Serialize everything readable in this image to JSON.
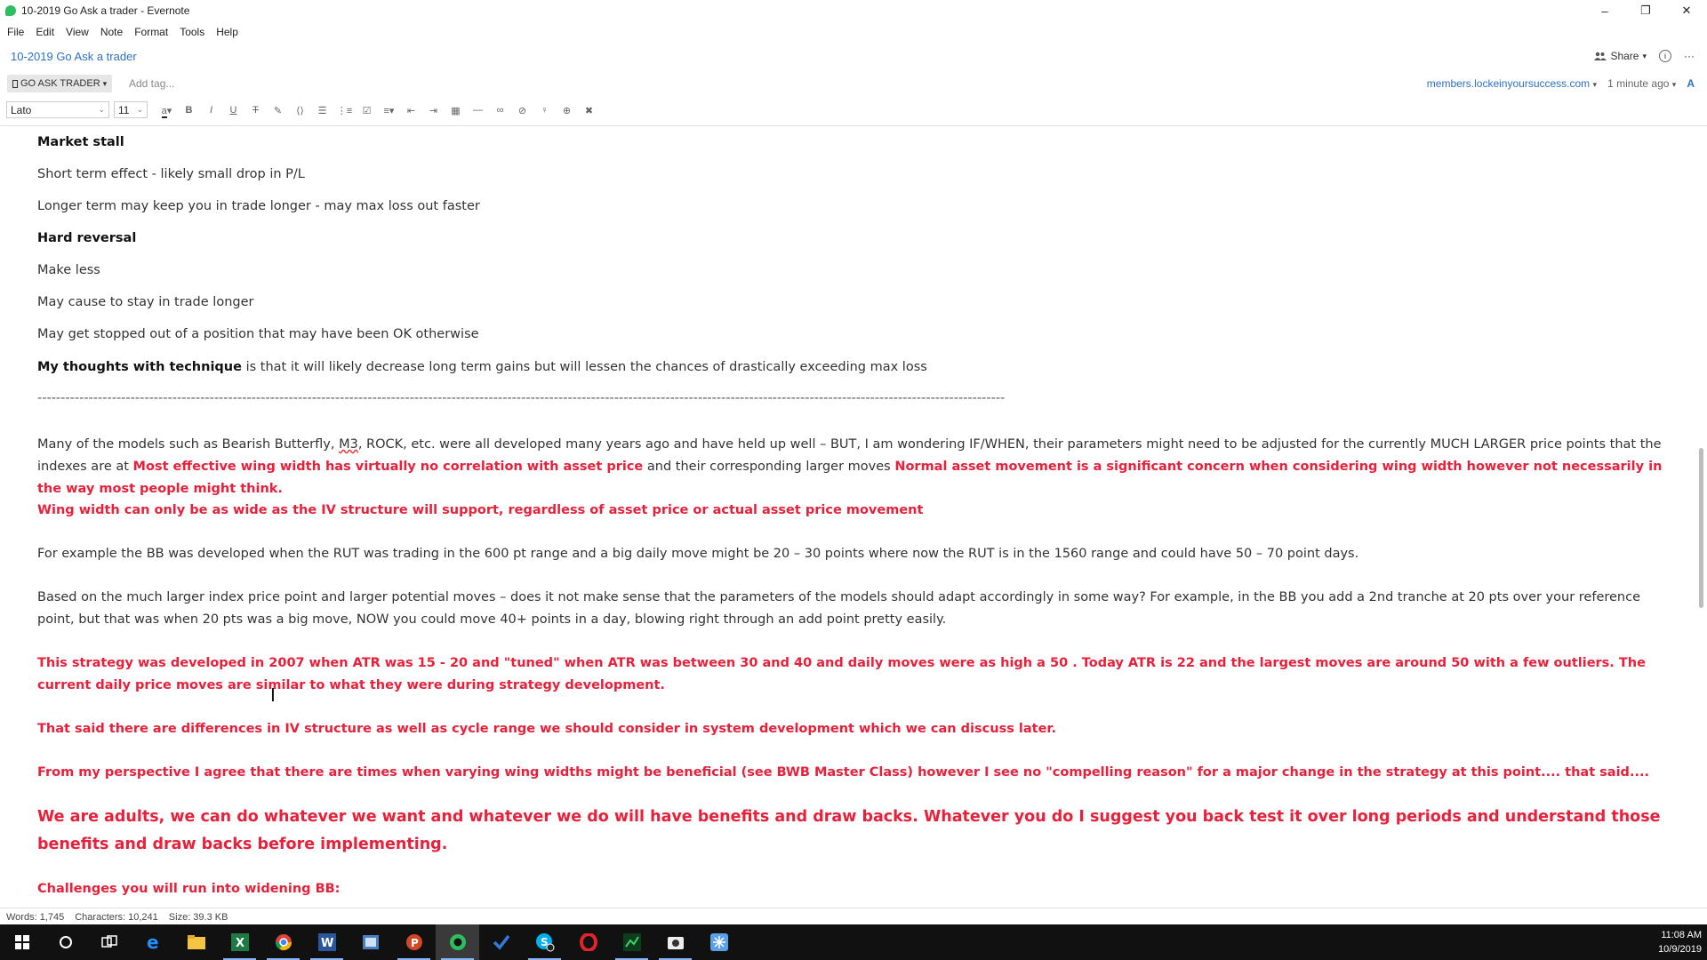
{
  "window": {
    "title": "10-2019 Go Ask a trader - Evernote",
    "controls": [
      "–",
      "❐",
      "✕"
    ]
  },
  "menu": [
    "File",
    "Edit",
    "View",
    "Note",
    "Format",
    "Tools",
    "Help"
  ],
  "note_header": {
    "title": "10-2019 Go Ask a trader",
    "share_label": "Share"
  },
  "tag_bar": {
    "notebook": "GO ASK TRADER",
    "add_tag_placeholder": "Add tag...",
    "source_url": "members.lockeinyoursuccess.com",
    "updated": "1 minute ago"
  },
  "toolbar": {
    "font": "Lato",
    "size": "11",
    "icons": [
      "text-color-icon",
      "bold-icon",
      "italic-icon",
      "underline-icon",
      "strikethrough-icon",
      "highlight-icon",
      "code-icon",
      "bullet-list-icon",
      "numbered-list-icon",
      "checkbox-icon",
      "align-icon",
      "outdent-icon",
      "indent-icon",
      "table-icon",
      "horizontal-rule-icon",
      "link-icon",
      "attach-icon",
      "record-icon",
      "insert-icon",
      "clear-format-icon"
    ]
  },
  "content": {
    "h_market_stall": "Market stall",
    "p1": "Short term effect - likely small drop in P/L",
    "p2": "Longer term may keep you in trade longer  - may max loss out faster",
    "h_hard_reversal": "Hard reversal",
    "p3": "Make less",
    "p4": "May cause to stay in trade longer",
    "p5": "May get stopped out of a position that may have been OK otherwise",
    "thoughts_bold": "My thoughts with technique",
    "thoughts_rest": " is that it will likely decrease long term gains but will lessen the chances of drastically exceeding max loss",
    "dashes": "----------------------------------------------------------------------------------------------------------------------------------------------------------------------------------------------------------------",
    "para_models_a": "Many of the models such as Bearish Butterfly, ",
    "para_models_m3": "M3",
    "para_models_b": ", ROCK, etc. were all developed many years ago and have held up well – BUT, I am wondering IF/WHEN, their parameters might need to be adjusted for the currently MUCH LARGER price points that the indexes are at ",
    "para_models_red1": "Most effective wing width has virtually no correlation with asset price",
    "para_models_c": " and their corresponding larger moves ",
    "para_models_red2": "Normal asset movement is a significant concern when considering wing width however not necessarily in the way most people might think.",
    "wing_width": "Wing width can only be as wide as the IV structure will support, regardless of asset price or actual asset price movement",
    "example": "For example the BB was developed when the RUT was trading in the 600 pt range and a big daily move might be 20 – 30 points where now the RUT is in the 1560 range and could have 50 – 70 point days.",
    "based_on": " Based on the much larger index price point and larger potential moves – does it not make sense that the parameters of the models should adapt accordingly in some way?  For example, in the BB you add a 2nd tranche at 20 pts over your reference point, but that was when 20 pts was a big move, NOW you could move 40+ points in a day, blowing right through an add point pretty easily.",
    "strategy_dev": "This strategy was developed in 2007 when ATR was 15 - 20 and \"tuned\" when ATR was between 30 and 40 and daily moves were as high a 50 . Today ATR is 22 and the largest moves  are  around 50 with a few outliers. The current daily price moves are similar to what they were during strategy development.",
    "that_said": "That said there are differences in IV structure as well as cycle range we should consider in system development which we can discuss later.",
    "perspective": "From my perspective I agree that there are times when varying wing  widths might be beneficial (see BWB Master Class) however I see no \"compelling reason\" for a major change in the strategy at this point.... that said....",
    "adults": "We are adults, we can do whatever we want and whatever we do will have benefits and draw backs. Whatever you do I suggest  you back test it over long periods and understand those benefits and draw backs before implementing.",
    "challenges": "Challenges you will run into widening BB:"
  },
  "status": {
    "words": "Words: 1,745",
    "characters": "Characters: 10,241",
    "size": "Size: 39.3 KB"
  },
  "taskbar": {
    "apps": [
      "windows-start-icon",
      "cortana-search-icon",
      "task-view-icon",
      "edge-browser-icon",
      "file-explorer-icon",
      "excel-icon",
      "chrome-icon",
      "word-icon",
      "reader-icon",
      "powerpoint-icon",
      "evernote-icon",
      "todo-check-icon",
      "skype-icon",
      "opera-icon",
      "trading-app-icon",
      "camera-app-icon",
      "snowflake-app-icon"
    ],
    "time": "11:08 AM",
    "date": "10/9/2019"
  },
  "colors": {
    "accent_blue": "#2b71c8",
    "red_text": "#e8203a",
    "evernote_green": "#2dbe60"
  }
}
